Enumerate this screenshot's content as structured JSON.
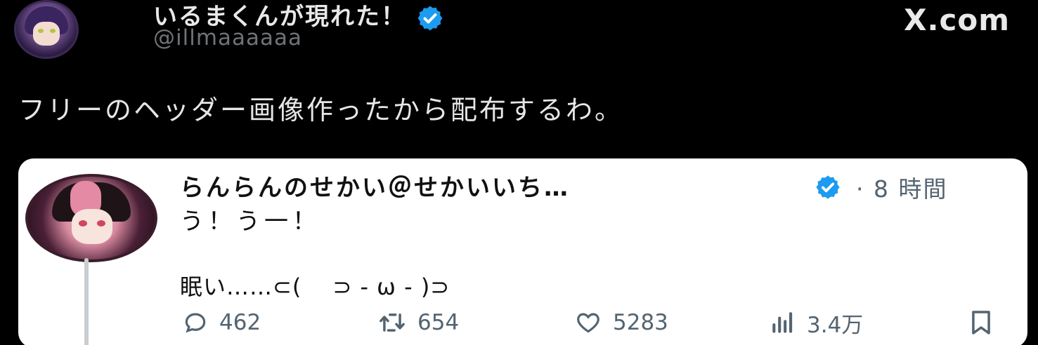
{
  "post": {
    "display_name": "いるまくんが現れた！",
    "handle": "@illmaaaaaa",
    "brand": "X.com",
    "text": "フリーのヘッダー画像作ったから配布するわ。"
  },
  "quote": {
    "display_name": "らんらんのせかい＠せかいいち…",
    "time": "· 8 時間",
    "line1": "う！う一！",
    "line2": "眠い……⊂(　 ⊃ - ω - )⊃",
    "actions": {
      "replies": "462",
      "reposts": "654",
      "likes": "5283",
      "views": "3.4万"
    }
  },
  "colors": {
    "background": "#000000",
    "verified": "#1d9bf0",
    "card": "#ffffff",
    "muted": "#536471"
  },
  "icons": [
    "verified-badge-icon",
    "reply-icon",
    "repost-icon",
    "like-icon",
    "views-icon",
    "bookmark-icon"
  ]
}
